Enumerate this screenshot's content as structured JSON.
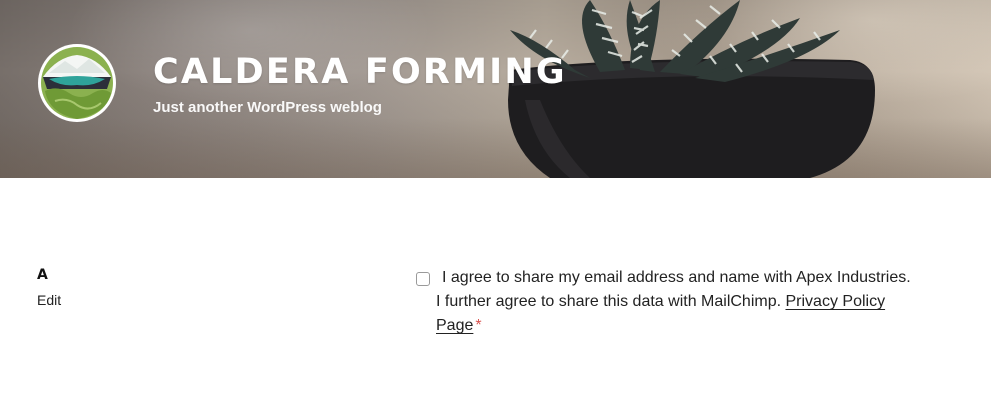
{
  "header": {
    "site_title": "CALDERA FORMING",
    "tagline": "Just another WordPress weblog",
    "logo_icon": "caldera-logo-icon",
    "background_image": "potted-succulent-plant"
  },
  "entry": {
    "title": "A",
    "edit_label": "Edit"
  },
  "consent": {
    "checked": false,
    "line1": "I agree to share my email address and name with Apex Industries.",
    "line2_prefix": "I further agree to share this data with MailChimp. ",
    "privacy_link_part1": "Privacy Policy",
    "privacy_link_part2": "Page",
    "required_mark": "*"
  },
  "colors": {
    "header_text": "#ffffff",
    "body_text": "#222222",
    "required": "#d9534f",
    "logo_green": "#8bb14f"
  }
}
